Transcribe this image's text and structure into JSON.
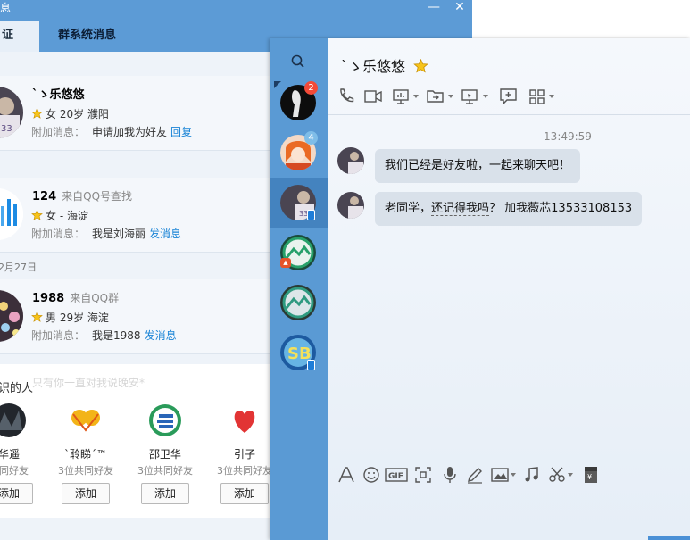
{
  "verify_window": {
    "title": "息",
    "minimize_label": "—",
    "close_label": "✕",
    "tabs": [
      {
        "label": "证"
      },
      {
        "label": "群系统消息"
      }
    ],
    "requests": [
      {
        "name": "`ゝ乐悠悠",
        "source": "",
        "info": "女 20岁 濮阳",
        "extra_label": "附加消息：",
        "extra_text": "申请加我为好友",
        "action": "回复"
      },
      {
        "name": "124",
        "source": "来自QQ号查找",
        "info": "女 - 海淀",
        "extra_label": "附加消息：",
        "extra_text": "我是刘海丽",
        "action": "发消息"
      },
      {
        "name": "1988",
        "source": "来自QQ群",
        "info": "男 29岁 海淀",
        "extra_label": "附加消息：",
        "extra_text": "我是1988",
        "action": "发消息"
      }
    ],
    "date_separator": "2月27日",
    "recommend_header": "识的人",
    "ghost_texts": [
      "只有你一直对我说晚安*"
    ],
    "recommendations": [
      {
        "name": "华遥",
        "common": "共同好友",
        "add_label": "添加"
      },
      {
        "name": "`聆睇´™",
        "common": "3位共同好友",
        "add_label": "添加"
      },
      {
        "name": "邵卫华",
        "common": "3位共同好友",
        "add_label": "添加"
      },
      {
        "name": "引子",
        "common": "3位共同好友",
        "add_label": "添加"
      }
    ]
  },
  "chat_window": {
    "contacts": [
      {
        "name": "contact-1",
        "badge": "2",
        "badge_color": "#f24a38"
      },
      {
        "name": "contact-2",
        "badge": "4",
        "badge_color": "#7fbde8"
      },
      {
        "name": "contact-3",
        "badge": ""
      },
      {
        "name": "contact-4",
        "badge": ""
      },
      {
        "name": "contact-5",
        "badge": ""
      },
      {
        "name": "contact-6",
        "badge": ""
      }
    ],
    "title": "`ゝ乐悠悠",
    "timestamp": "13:49:59",
    "messages": [
      {
        "text": "我们已经是好友啦，一起来聊天吧！"
      },
      {
        "text_a": "老同学，",
        "text_b": "还记得我吗",
        "text_c": "？ 加我薇芯13533108153"
      }
    ],
    "colors": {
      "accent": "#5a9ad4",
      "bubble": "#d9e1ea",
      "badge_red": "#f24a38",
      "link": "#1a84d6"
    }
  }
}
